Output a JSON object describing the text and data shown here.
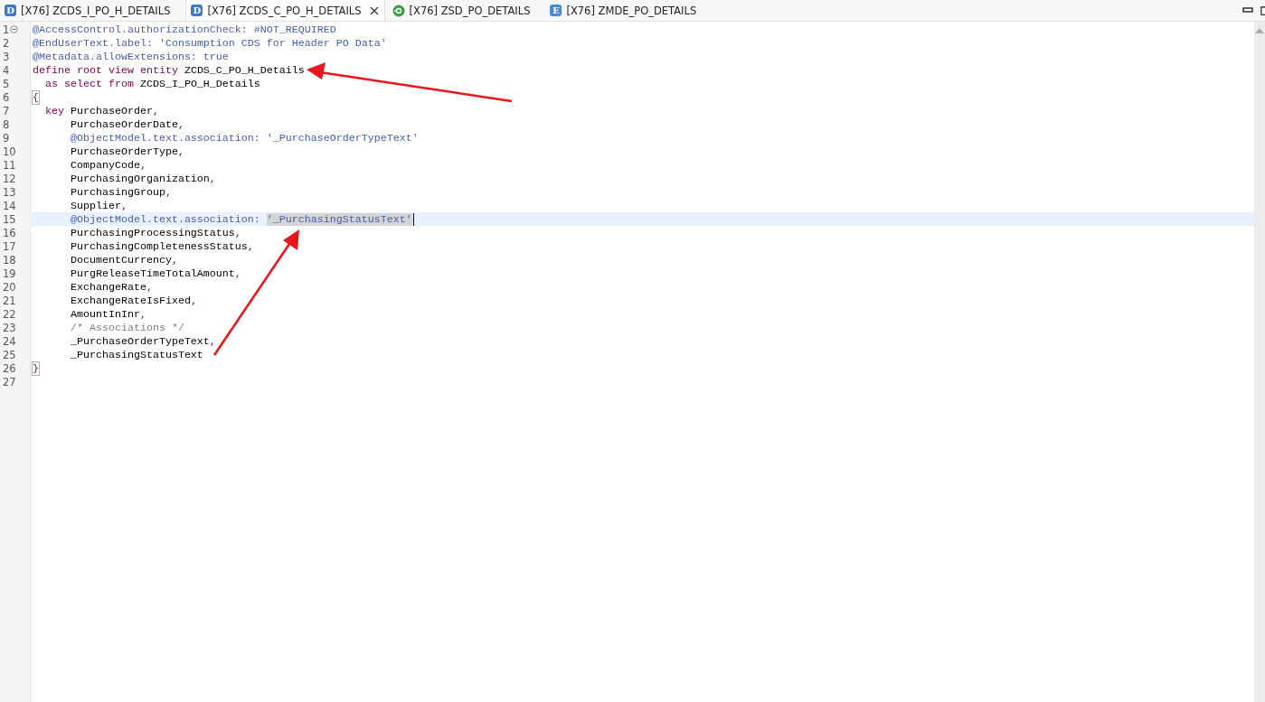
{
  "tabs": [
    {
      "label": "[X76] ZCDS_I_PO_H_DETAILS",
      "icon": {
        "kind": "letter",
        "text": "D"
      },
      "selected": false
    },
    {
      "label": "[X76] ZCDS_C_PO_H_DETAILS",
      "icon": {
        "kind": "letter",
        "text": "D"
      },
      "selected": true
    },
    {
      "label": "[X76] ZSD_PO_DETAILS",
      "icon": {
        "kind": "service"
      },
      "selected": false
    },
    {
      "label": "[X76] ZMDE_PO_DETAILS",
      "icon": {
        "kind": "letter",
        "text": "E"
      },
      "selected": false
    }
  ],
  "lines": [
    {
      "number": "1",
      "fold": true,
      "current": false,
      "tokens": [
        {
          "kind": "annotation",
          "text": "@AccessControl.authorizationCheck: #NOT_REQUIRED"
        }
      ]
    },
    {
      "number": "2",
      "fold": false,
      "current": false,
      "tokens": [
        {
          "kind": "annotation",
          "text": "@EndUserText.label: "
        },
        {
          "kind": "string",
          "text": "'Consumption CDS for Header PO Data'"
        }
      ]
    },
    {
      "number": "3",
      "fold": false,
      "current": false,
      "tokens": [
        {
          "kind": "annotation",
          "text": "@Metadata.allowExtensions: true"
        }
      ]
    },
    {
      "number": "4",
      "fold": false,
      "current": false,
      "tokens": [
        {
          "kind": "keyword",
          "text": "define root view entity"
        },
        {
          "kind": "plain",
          "text": " ZCDS_C_PO_H_Details"
        }
      ]
    },
    {
      "number": "5",
      "fold": false,
      "current": false,
      "tokens": [
        {
          "kind": "keyword",
          "text": "  as select from"
        },
        {
          "kind": "plain",
          "text": " ZCDS_I_PO_H_Details"
        }
      ]
    },
    {
      "number": "6",
      "fold": false,
      "current": false,
      "tokens": [
        {
          "kind": "brace",
          "text": "{"
        }
      ]
    },
    {
      "number": "7",
      "fold": false,
      "current": false,
      "tokens": [
        {
          "kind": "keyword",
          "text": "  key"
        },
        {
          "kind": "plain",
          "text": " PurchaseOrder"
        },
        {
          "kind": "punct",
          "text": ","
        }
      ]
    },
    {
      "number": "8",
      "fold": false,
      "current": false,
      "tokens": [
        {
          "kind": "plain",
          "text": "      PurchaseOrderDate"
        },
        {
          "kind": "punct",
          "text": ","
        }
      ]
    },
    {
      "number": "9",
      "fold": false,
      "current": false,
      "tokens": [
        {
          "kind": "annotation",
          "text": "      @ObjectModel.text.association: "
        },
        {
          "kind": "string",
          "text": "'_PurchaseOrderTypeText'"
        }
      ]
    },
    {
      "number": "10",
      "fold": false,
      "current": false,
      "tokens": [
        {
          "kind": "plain",
          "text": "      PurchaseOrderType"
        },
        {
          "kind": "punct",
          "text": ","
        }
      ]
    },
    {
      "number": "11",
      "fold": false,
      "current": false,
      "tokens": [
        {
          "kind": "plain",
          "text": "      CompanyCode"
        },
        {
          "kind": "punct",
          "text": ","
        }
      ]
    },
    {
      "number": "12",
      "fold": false,
      "current": false,
      "tokens": [
        {
          "kind": "plain",
          "text": "      PurchasingOrganization"
        },
        {
          "kind": "punct",
          "text": ","
        }
      ]
    },
    {
      "number": "13",
      "fold": false,
      "current": false,
      "tokens": [
        {
          "kind": "plain",
          "text": "      PurchasingGroup"
        },
        {
          "kind": "punct",
          "text": ","
        }
      ]
    },
    {
      "number": "14",
      "fold": false,
      "current": false,
      "tokens": [
        {
          "kind": "plain",
          "text": "      Supplier"
        },
        {
          "kind": "punct",
          "text": ","
        }
      ]
    },
    {
      "number": "15",
      "fold": false,
      "current": true,
      "tokens": [
        {
          "kind": "annotation",
          "text": "      @ObjectModel.text.association: "
        },
        {
          "kind": "selection",
          "text": "'_PurchasingStatusText'"
        }
      ]
    },
    {
      "number": "16",
      "fold": false,
      "current": false,
      "tokens": [
        {
          "kind": "plain",
          "text": "      PurchasingProcessingStatus"
        },
        {
          "kind": "punct",
          "text": ","
        }
      ]
    },
    {
      "number": "17",
      "fold": false,
      "current": false,
      "tokens": [
        {
          "kind": "plain",
          "text": "      PurchasingCompletenessStatus"
        },
        {
          "kind": "punct",
          "text": ","
        }
      ]
    },
    {
      "number": "18",
      "fold": false,
      "current": false,
      "tokens": [
        {
          "kind": "plain",
          "text": "      DocumentCurrency"
        },
        {
          "kind": "punct",
          "text": ","
        }
      ]
    },
    {
      "number": "19",
      "fold": false,
      "current": false,
      "tokens": [
        {
          "kind": "plain",
          "text": "      PurgReleaseTimeTotalAmount"
        },
        {
          "kind": "punct",
          "text": ","
        }
      ]
    },
    {
      "number": "20",
      "fold": false,
      "current": false,
      "tokens": [
        {
          "kind": "plain",
          "text": "      ExchangeRate"
        },
        {
          "kind": "punct",
          "text": ","
        }
      ]
    },
    {
      "number": "21",
      "fold": false,
      "current": false,
      "tokens": [
        {
          "kind": "plain",
          "text": "      ExchangeRateIsFixed"
        },
        {
          "kind": "punct",
          "text": ","
        }
      ]
    },
    {
      "number": "22",
      "fold": false,
      "current": false,
      "tokens": [
        {
          "kind": "plain",
          "text": "      AmountInInr"
        },
        {
          "kind": "punct",
          "text": ","
        }
      ]
    },
    {
      "number": "23",
      "fold": false,
      "current": false,
      "tokens": [
        {
          "kind": "comment",
          "text": "      /* Associations */"
        }
      ]
    },
    {
      "number": "24",
      "fold": false,
      "current": false,
      "tokens": [
        {
          "kind": "plain",
          "text": "      _PurchaseOrderTypeText"
        },
        {
          "kind": "punct",
          "text": ","
        }
      ]
    },
    {
      "number": "25",
      "fold": false,
      "current": false,
      "tokens": [
        {
          "kind": "plain",
          "text": "      _PurchasingStatusText"
        }
      ]
    },
    {
      "number": "26",
      "fold": false,
      "current": false,
      "tokens": [
        {
          "kind": "brace",
          "text": "}"
        }
      ]
    },
    {
      "number": "27",
      "fold": false,
      "current": false
    }
  ]
}
